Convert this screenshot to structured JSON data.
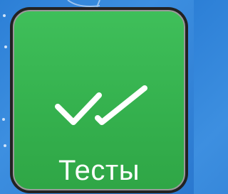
{
  "tile": {
    "label": "Тесты",
    "icon": "double-check-icon"
  },
  "colors": {
    "background": "#2c7fd6",
    "tile": "#36b24f",
    "frame": "#222222",
    "icon": "#ffffff",
    "text": "#ffffff"
  }
}
